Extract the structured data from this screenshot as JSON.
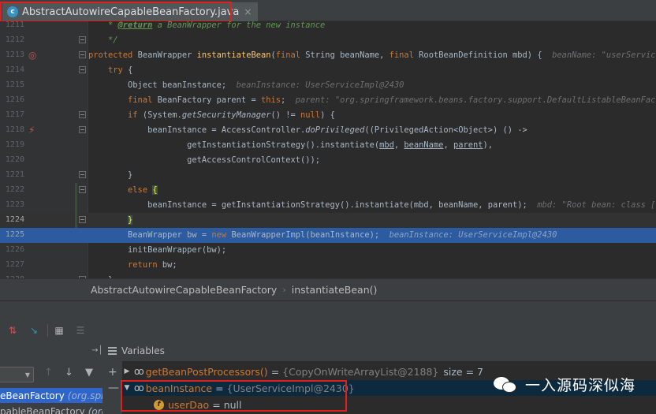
{
  "tab": {
    "title": "AbstractAutowireCapableBeanFactory.java",
    "close": "×",
    "icon_letter": "c"
  },
  "editor": {
    "lines": [
      {
        "num": "1211",
        "code": "    * @return a BeanWrapper for the new instance"
      },
      {
        "num": "1212",
        "code": "    */"
      },
      {
        "num": "1213",
        "code": "protected BeanWrapper instantiateBean(final String beanName, final RootBeanDefinition mbd) {",
        "hint": "beanName: \"userService"
      },
      {
        "num": "1214",
        "code": "    try {"
      },
      {
        "num": "1215",
        "code": "        Object beanInstance;",
        "hint": "beanInstance: UserServiceImpl@2430"
      },
      {
        "num": "1216",
        "code": "        final BeanFactory parent = this;",
        "hint": "parent: \"org.springframework.beans.factory.support.DefaultListableBeanFact"
      },
      {
        "num": "1217",
        "code": "        if (System.getSecurityManager() != null) {"
      },
      {
        "num": "1218",
        "code": "            beanInstance = AccessController.doPrivileged((PrivilegedAction<Object>) () ->"
      },
      {
        "num": "1219",
        "code": "                    getInstantiationStrategy().instantiate(mbd, beanName, parent),"
      },
      {
        "num": "1220",
        "code": "                    getAccessControlContext());"
      },
      {
        "num": "1221",
        "code": "        }"
      },
      {
        "num": "1222",
        "code": "        else {"
      },
      {
        "num": "1223",
        "code": "            beanInstance = getInstantiationStrategy().instantiate(mbd, beanName, parent);",
        "hint": "mbd: \"Root bean: class [c"
      },
      {
        "num": "1224",
        "code": "        }"
      },
      {
        "num": "1225",
        "code": "        BeanWrapper bw = new BeanWrapperImpl(beanInstance);",
        "hint": "beanInstance: UserServiceImpl@2430"
      },
      {
        "num": "1226",
        "code": "        initBeanWrapper(bw);"
      },
      {
        "num": "1227",
        "code": "        return bw;"
      },
      {
        "num": "1228",
        "code": "    }"
      }
    ]
  },
  "breadcrumb": {
    "class_name": "AbstractAutowireCapableBeanFactory",
    "separator": "›",
    "method_name": "instantiateBean()"
  },
  "debugger": {
    "variables_label": "Variables",
    "frames": [
      {
        "name": "eBeanFactory",
        "pkg": "(org.spri"
      },
      {
        "name": "pableBeanFactory",
        "pkg": "(org.s"
      }
    ],
    "variables": [
      {
        "name": "getBeanPostProcessors()",
        "value": "{CopyOnWriteArrayList@2188}",
        "extra": "size = 7"
      },
      {
        "name": "beanInstance",
        "value": "{UserServiceImpl@2430}"
      },
      {
        "name": "userDao",
        "value": "null"
      }
    ]
  },
  "watermark": {
    "text": "一入源码深似海"
  },
  "colors": {
    "accent_red": "#e0201e",
    "exec_line": "#2d5b9f",
    "selected_frame": "#2f65ca"
  }
}
